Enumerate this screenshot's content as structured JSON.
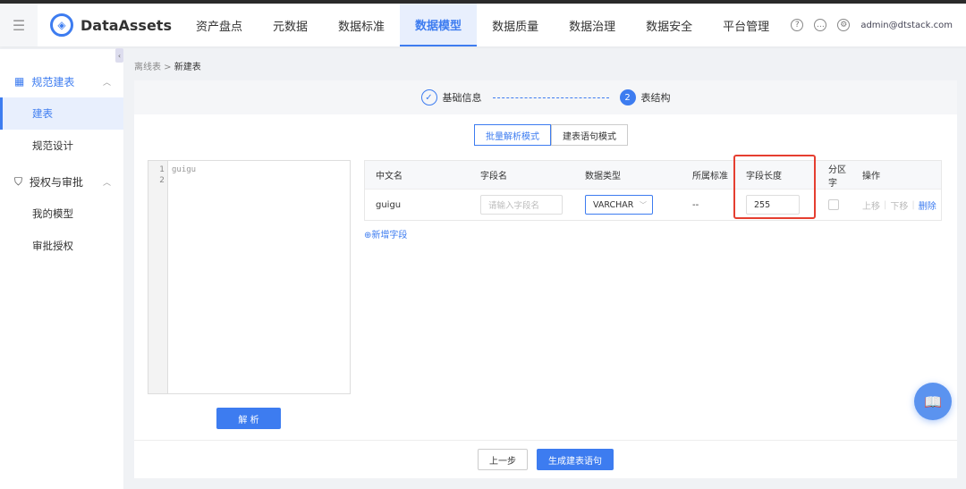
{
  "header": {
    "brand": "DataAssets",
    "nav": [
      "资产盘点",
      "元数据",
      "数据标准",
      "数据模型",
      "数据质量",
      "数据治理",
      "数据安全",
      "平台管理"
    ],
    "active": "数据模型",
    "user": "admin@dtstack.com"
  },
  "sidebar": {
    "group1": "规范建表",
    "items1": [
      "建表",
      "规范设计"
    ],
    "group2": "授权与审批",
    "items2": [
      "我的模型",
      "审批授权"
    ]
  },
  "breadcrumb": {
    "parent": "离线表",
    "current": "新建表"
  },
  "steps": {
    "step1": "基础信息",
    "step2_num": "2",
    "step2": "表结构"
  },
  "modes": {
    "batch": "批量解析模式",
    "sql": "建表语句模式"
  },
  "editor": {
    "lines": [
      "1",
      "2"
    ],
    "code": "guigu"
  },
  "parse_label": "解 析",
  "table": {
    "headers": [
      "中文名",
      "字段名",
      "数据类型",
      "所属标准",
      "字段长度",
      "分区字",
      "操作"
    ],
    "row": {
      "cn_name": "guigu",
      "field_placeholder": "请输入字段名",
      "type": "VARCHAR",
      "standard": "--",
      "length": "255",
      "ops": [
        "上移",
        "下移",
        "删除"
      ]
    }
  },
  "add_field": "新增字段",
  "footer": {
    "prev": "上一步",
    "generate": "生成建表语句"
  },
  "colors": {
    "accent": "#3d7cf0",
    "highlight": "#e53e30"
  }
}
